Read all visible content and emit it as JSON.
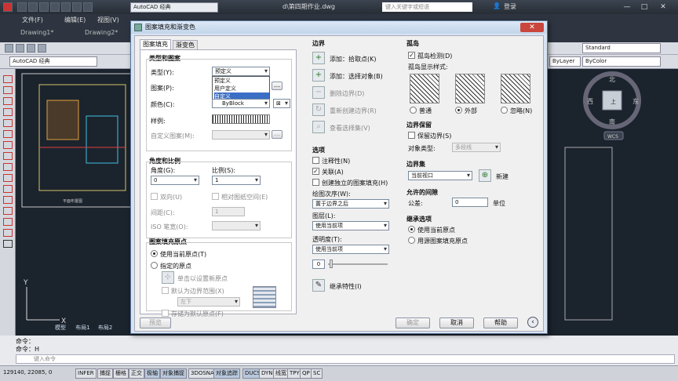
{
  "app": {
    "title": "AutoCAD 经典",
    "file": "d\\第四期作业.dwg",
    "search_placeholder": "键入关键字或短语",
    "login": "登录",
    "menus": [
      "文件(F)",
      "编辑(E)",
      "视图(V)"
    ],
    "doc_tabs": [
      "Drawing1*",
      "Drawing2*"
    ],
    "workspace": "AutoCAD 经典",
    "style_combo": "Standard",
    "layer_combo": "ByLayer",
    "color_combo": "ByColor",
    "model_tabs": [
      "模型",
      "布局1",
      "布局2"
    ],
    "viewcube": {
      "north": "北",
      "east": "东",
      "south": "南",
      "west": "西",
      "top": "上",
      "wcs": "WCS"
    },
    "drawing_label": "平面布置图",
    "ucs": {
      "x": "X",
      "y": "Y"
    }
  },
  "command": {
    "lines": [
      "命令：",
      "命令：H"
    ],
    "input_placeholder": "键入命令"
  },
  "status": {
    "coords": "129140, 22085, 0",
    "buttons": [
      "INFER",
      "捕捉",
      "栅格",
      "正交",
      "极轴",
      "对象捕捉",
      "3DOSNAP",
      "对象追踪",
      "DUCS",
      "DYN",
      "线宽",
      "TPY",
      "QP",
      "SC"
    ]
  },
  "dialog": {
    "title": "图案填充和渐变色",
    "close": "✕",
    "tabs": [
      "图案填充",
      "渐变色"
    ],
    "type_and_pattern": {
      "heading": "类型和图案",
      "type_label": "类型(Y):",
      "type_value": "预定义",
      "type_options": [
        "预定义",
        "用户定义",
        "自定义"
      ],
      "pattern_label": "图案(P):",
      "color_label": "颜色(C):",
      "color_value": "ByBlock",
      "swatch_label": "样例:",
      "custom_label": "自定义图案(M):"
    },
    "angle_scale": {
      "heading": "角度和比例",
      "angle_label": "角度(G):",
      "angle_value": "0",
      "scale_label": "比例(S):",
      "scale_value": "1",
      "double": "双向(U)",
      "relative": "相对图纸空间(E)",
      "spacing_label": "间距(C):",
      "spacing_value": "1",
      "iso_label": "ISO 笔宽(O):"
    },
    "origin": {
      "heading": "图案填充原点",
      "use_current": "使用当前原点(T)",
      "specified": "指定的原点",
      "click_set": "单击以设置新原点",
      "default_boundary": "默认为边界范围(X)",
      "position": "左下",
      "store_default": "存储为默认原点(F)"
    },
    "boundary": {
      "heading": "边界",
      "add_pick": "添加：拾取点(K)",
      "add_select": "添加：选择对象(B)",
      "remove": "删除边界(D)",
      "recreate": "重新创建边界(R)",
      "view": "查看选择集(V)"
    },
    "options": {
      "heading": "选项",
      "annotative": "注释性(N)",
      "associative": "关联(A)",
      "separate": "创建独立的图案填充(H)",
      "draw_order_label": "绘图次序(W):",
      "draw_order_value": "置于边界之后",
      "layer_label": "图层(L):",
      "layer_value": "使用当前项",
      "transparency_label": "透明度(T):",
      "transparency_value": "使用当前项",
      "transparency_number": "0",
      "inherit": "继承特性(I)"
    },
    "islands": {
      "heading": "孤岛",
      "detect": "孤岛检测(D)",
      "style_label": "孤岛显示样式:",
      "styles": [
        "普通",
        "外部",
        "忽略(N)"
      ],
      "selected_style": "外部"
    },
    "boundary_retention": {
      "heading": "边界保留",
      "retain": "保留边界(S)",
      "object_type_label": "对象类型:",
      "object_type_value": "多段线"
    },
    "boundary_set": {
      "heading": "边界集",
      "value": "当前视口",
      "new": "新建"
    },
    "gap": {
      "heading": "允许的间隙",
      "tolerance_label": "公差:",
      "tolerance_value": "0",
      "unit": "单位"
    },
    "inherit_options": {
      "heading": "继承选项",
      "use_current": "使用当前原点",
      "use_source": "用源图案填充原点"
    },
    "footer": {
      "preview": "预览",
      "ok": "确定",
      "cancel": "取消",
      "help": "帮助"
    }
  }
}
